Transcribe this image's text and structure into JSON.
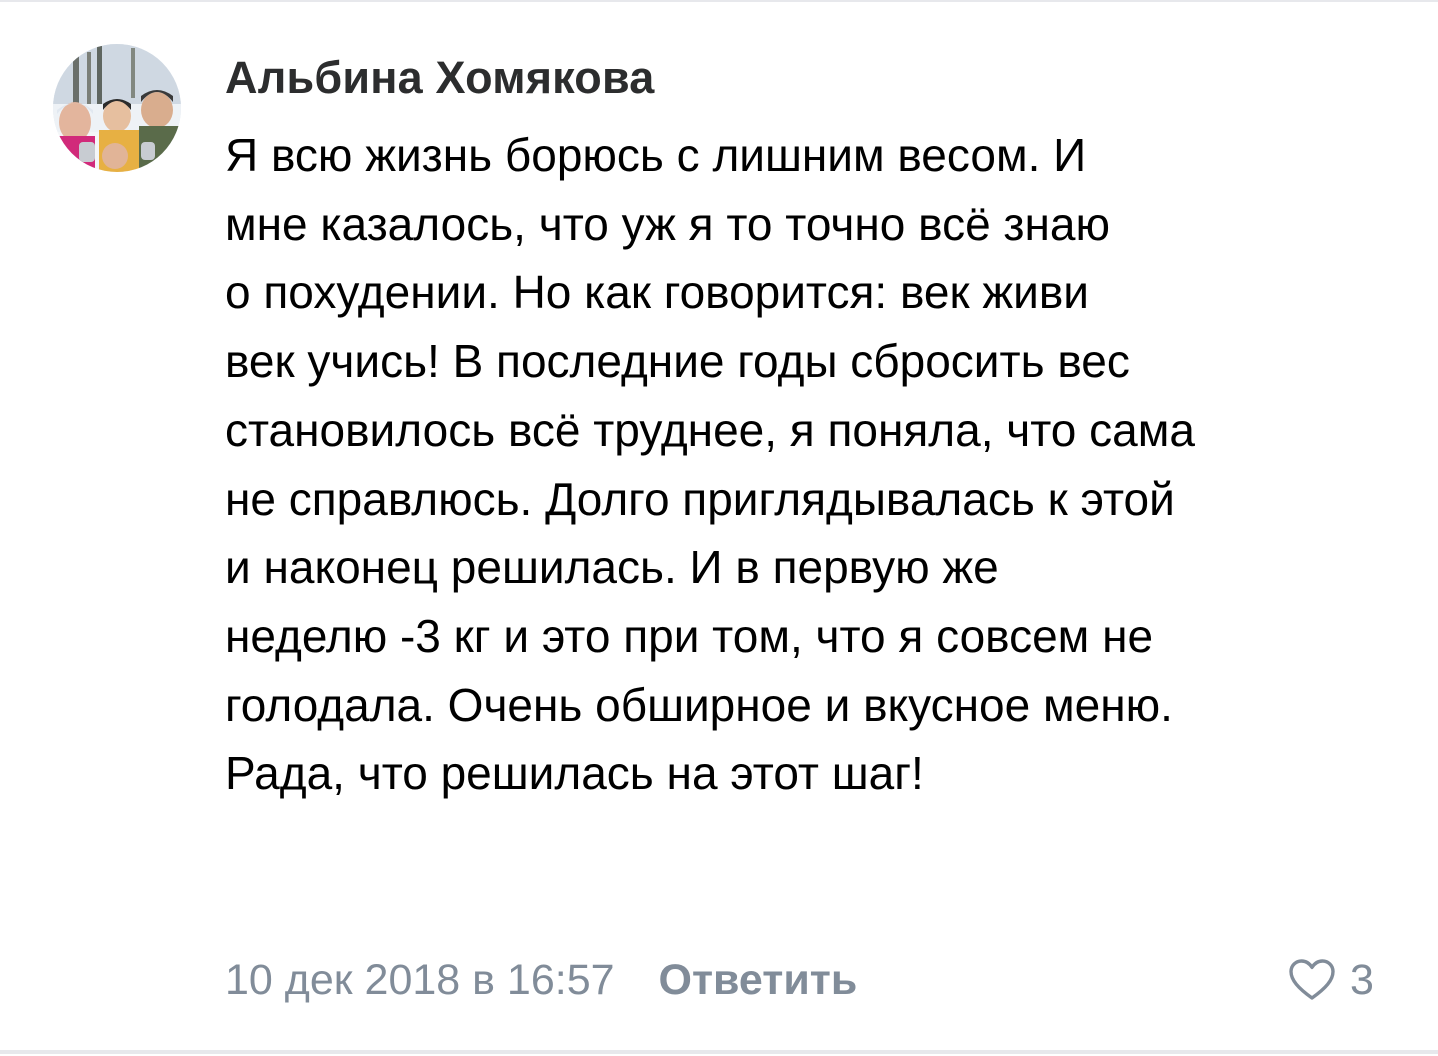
{
  "comment": {
    "author": "Альбина Хомякова",
    "lines": [
      "Я всю жизнь борюсь с лишним весом. И",
      "мне казалось, что уж я то точно всё знаю",
      "о похудении. Но как говорится: век живи",
      "век учись! В последние годы сбросить вес",
      "становилось всё труднее, я поняла, что сама",
      "не справлюсь. Долго приглядывалась к этой",
      "и наконец решилась. И в первую же",
      "неделю -3 кг и это при том, что я совсем не",
      "голодала. Очень обширное и вкусное меню.",
      "Рада, что решилась на этот шаг!"
    ],
    "date": "10 дек 2018 в 16:57",
    "reply_label": "Ответить",
    "likes": "3",
    "like_icon": "heart-outline-icon"
  },
  "colors": {
    "text": "#000000",
    "author": "#2c2d2e",
    "secondary": "#818c99",
    "divider": "#e7e8ec"
  }
}
